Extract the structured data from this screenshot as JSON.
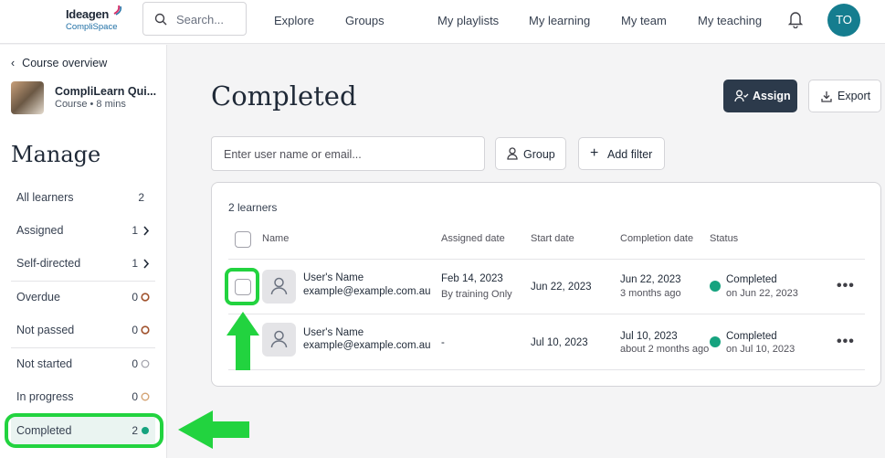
{
  "brand": {
    "name": "Ideagen",
    "product": "CompliSpace"
  },
  "search": {
    "placeholder": "Search..."
  },
  "nav": {
    "explore": "Explore",
    "groups": "Groups",
    "my_playlists": "My playlists",
    "my_learning": "My learning",
    "my_team": "My team",
    "my_teaching": "My teaching"
  },
  "user": {
    "initials": "TO"
  },
  "colors": {
    "accent": "#2c3a4b",
    "avatar": "#157d8f",
    "completed": "#16a37f",
    "highlight": "#22d33f",
    "overdue": "#a0522d",
    "in_progress": "#d4a373"
  },
  "sidebar": {
    "back_label": "Course overview",
    "course_title": "CompliLearn Qui...",
    "course_meta": "Course • 8 mins",
    "heading": "Manage",
    "items": [
      {
        "label": "All learners",
        "count": "2"
      },
      {
        "label": "Assigned",
        "count": "1"
      },
      {
        "label": "Self-directed",
        "count": "1"
      },
      {
        "label": "Overdue",
        "count": "0"
      },
      {
        "label": "Not passed",
        "count": "0"
      },
      {
        "label": "Not started",
        "count": "0"
      },
      {
        "label": "In progress",
        "count": "0"
      },
      {
        "label": "Completed",
        "count": "2"
      }
    ]
  },
  "main": {
    "title": "Completed",
    "assign_label": "Assign",
    "export_label": "Export",
    "user_search_placeholder": "Enter user name or email...",
    "group_label": "Group",
    "add_filter_label": "Add filter",
    "learner_count": "2 learners",
    "columns": {
      "name": "Name",
      "assigned": "Assigned date",
      "start": "Start date",
      "completion": "Completion date",
      "status": "Status"
    },
    "rows": [
      {
        "name": "User's Name",
        "email": "example@example.com.au",
        "assigned_date": "Feb 14, 2023",
        "assigned_by": "By training Only",
        "start_date": "Jun 22, 2023",
        "completion_date": "Jun 22, 2023",
        "completion_rel": "3 months ago",
        "status": "Completed",
        "status_sub": "on Jun 22, 2023",
        "more": "•••"
      },
      {
        "name": "User's Name",
        "email": "example@example.com.au",
        "assigned_date": "-",
        "assigned_by": "",
        "start_date": "Jul 10, 2023",
        "completion_date": "Jul 10, 2023",
        "completion_rel": "about 2 months ago",
        "status": "Completed",
        "status_sub": "on Jul 10, 2023",
        "more": "•••"
      }
    ]
  }
}
